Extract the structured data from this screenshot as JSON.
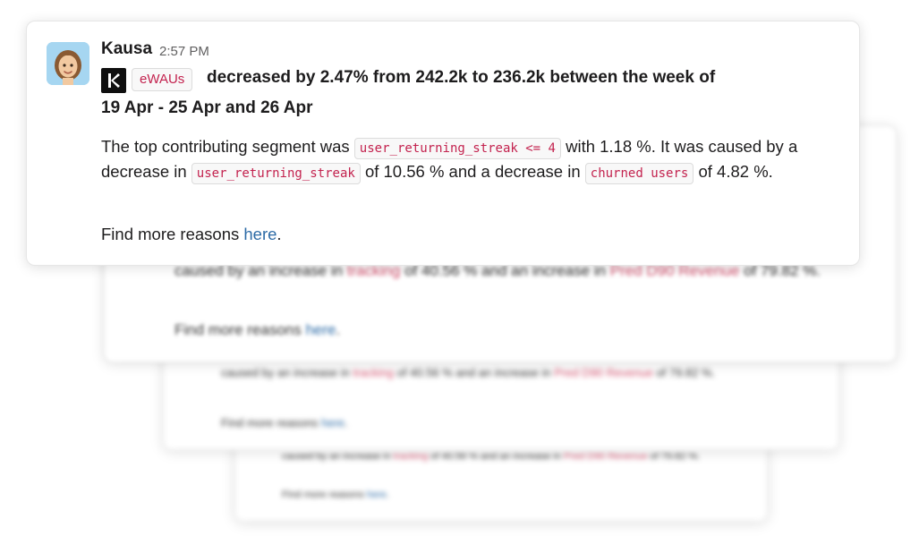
{
  "message": {
    "author": "Kausa",
    "time": "2:57 PM",
    "metric_tag": "eWAUs",
    "headline_line1": "decreased by 2.47% from 242.2k to 236.2k between the week of",
    "headline_line2": "19 Apr - 25 Apr and 26 Apr",
    "body": {
      "part1": "The top contributing segment was",
      "segment_tag": "user_returning_streak <= 4",
      "part2": "with 1.18 %. It was caused by a decrease in",
      "driver1_tag": "user_returning_streak",
      "part3": "of 10.56 % and a decrease in",
      "driver2_tag": "churned users",
      "part4": "of 4.82 %."
    },
    "more_prefix": "Find more reasons",
    "more_link": "here",
    "more_suffix": "."
  },
  "background_cards": [
    {
      "line": "caused by an increase in",
      "tag1": "tracking",
      "mid": "of 40.56 % and an increase in",
      "tag2": "Pred D90 Revenue",
      "end": "of 79.82 %.",
      "more_prefix": "Find more reasons",
      "more_link": "here",
      "more_suffix": "."
    },
    {
      "line": "caused by an increase in",
      "tag1": "tracking",
      "mid": "of 40.56 % and an increase in",
      "tag2": "Pred D90 Revenue",
      "end": "of 79.82 %.",
      "more_prefix": "Find more reasons",
      "more_link": "here",
      "more_suffix": "."
    },
    {
      "line": "caused by an increase in",
      "tag1": "tracking",
      "mid": "of 40.56 % and an increase in",
      "tag2": "Pred D90 Revenue",
      "end": "of 79.82 %.",
      "more_prefix": "Find more reasons",
      "more_link": "here",
      "more_suffix": "."
    }
  ],
  "colors": {
    "tag_text": "#c3224e",
    "link": "#2d6ba6",
    "avatar_bg": "#a6d6f1"
  }
}
